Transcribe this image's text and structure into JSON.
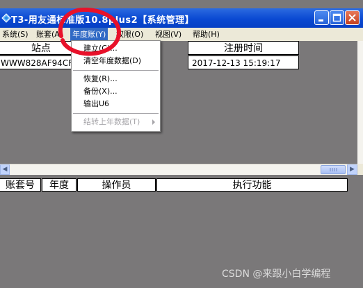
{
  "window": {
    "title": "T3-用友通标准版10.8plus2【系统管理】",
    "controls": {
      "minimize": "minimize-icon",
      "maximize": "maximize-icon",
      "close": "close-icon"
    }
  },
  "menubar": {
    "items": [
      "系统(S)",
      "账套(A)",
      "年度账(Y)",
      "权限(O)",
      "视图(V)",
      "帮助(H)"
    ],
    "active": "年度账(Y)"
  },
  "dropdown": {
    "items": [
      "建立(C)...",
      "清空年度数据(D)",
      "恢复(R)...",
      "备份(X)...",
      "输出U6",
      "结转上年数据(T)"
    ],
    "disabled": [
      "结转上年数据(T)"
    ]
  },
  "upper_table": {
    "columns": [
      "站点",
      "注册时间"
    ],
    "rows": [
      [
        "WWW828AF94CFO",
        "2017-12-13 15:19:17"
      ]
    ]
  },
  "lower_table": {
    "columns": [
      "账套号",
      "年度",
      "操作员",
      "执行功能"
    ]
  },
  "watermark": "CSDN @来跟小白学编程",
  "colors": {
    "title_bar": "#0a49d2",
    "menu_highlight": "#316ac5",
    "workspace": "#7a7879",
    "annotation": "#e8112a"
  }
}
